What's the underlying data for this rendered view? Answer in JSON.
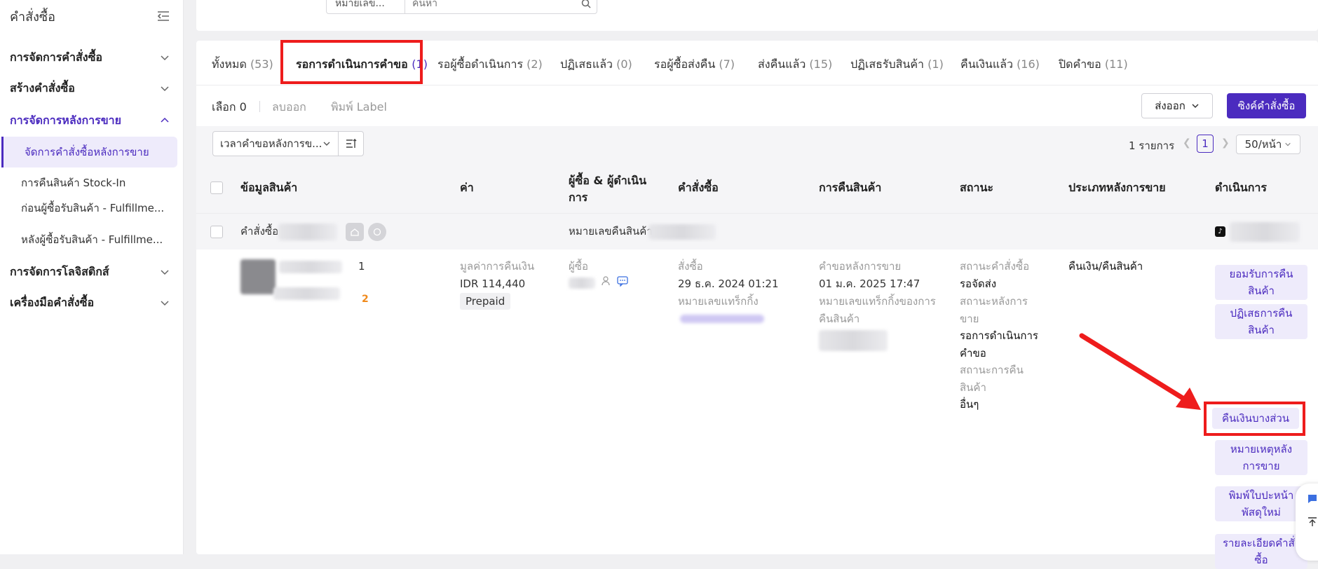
{
  "sidebar": {
    "title": "คำสั่งซื้อ",
    "items": [
      {
        "label": "การจัดการคำสั่งซื้อ"
      },
      {
        "label": "สร้างคำสั่งซื้อ"
      },
      {
        "label": "การจัดการหลังการขาย"
      },
      {
        "label": "การจัดการโลจิสติกส์"
      },
      {
        "label": "เครื่องมือคำสั่งซื้อ"
      }
    ],
    "subitems": [
      {
        "label": "จัดการคำสั่งซื้อหลังการขาย"
      },
      {
        "label": "การคืนสินค้า Stock-In"
      },
      {
        "label": "ก่อนผู้ซื้อรับสินค้า - Fulfillme..."
      },
      {
        "label": "หลังผู้ซื้อรับสินค้า - Fulfillme..."
      }
    ]
  },
  "search": {
    "type_label": "หมายเลข...",
    "placeholder": "ค้นหา"
  },
  "tabs": [
    {
      "label": "ทั้งหมด",
      "count": "(53)"
    },
    {
      "label": "รอการดำเนินการคำขอ",
      "count": "(1)"
    },
    {
      "label": "รอผู้ซื้อดำเนินการ",
      "count": "(2)"
    },
    {
      "label": "ปฏิเสธแล้ว",
      "count": "(0)"
    },
    {
      "label": "รอผู้ซื้อส่งคืน",
      "count": "(7)"
    },
    {
      "label": "ส่งคืนแล้ว",
      "count": "(15)"
    },
    {
      "label": "ปฏิเสธรับสินค้า",
      "count": "(1)"
    },
    {
      "label": "คืนเงินแล้ว",
      "count": "(16)"
    },
    {
      "label": "ปิดคำขอ",
      "count": "(11)"
    }
  ],
  "toolbar": {
    "selected": "เลือก 0",
    "remove": "ลบออก",
    "print_label": "พิมพ์ Label",
    "export": "ส่งออก",
    "sync": "ซิงค์คำสั่งซื้อ"
  },
  "filter": {
    "sort_label": "เวลาคำขอหลังการข..."
  },
  "pager": {
    "total": "1 รายการ",
    "page": "1",
    "page_size": "50/หน้า"
  },
  "table": {
    "headers": [
      "ข้อมูลสินค้า",
      "ค่า",
      "ผู้ซื้อ & ผู้ดำเนินการ",
      "คำสั่งซื้อ",
      "การคืนสินค้า",
      "สถานะ",
      "ประเภทหลังการขาย",
      "ดำเนินการ"
    ],
    "order_label": "คำสั่งซื้อ",
    "return_no_label": "หมายเลขคืนสินค้า",
    "row": {
      "product_suffix": "1",
      "quantity": "2",
      "refund_label": "มูลค่าการคืนเงิน",
      "refund_amount": "IDR 114,440",
      "payment_tag": "Prepaid",
      "buyer_label": "ผู้ซื้อ",
      "order_label": "สั่งซื้อ",
      "order_time": "29 ธ.ค. 2024 01:21",
      "tracking_label": "หมายเลขแทร็กกิ้ง",
      "after_sale_label": "คำขอหลังการขาย",
      "after_sale_time": "01 ม.ค. 2025 17:47",
      "return_tracking_label": "หมายเลขแทร็กกิ้งของการคืนสินค้า",
      "order_status_label": "สถานะคำสั่งซื้อ",
      "order_status": "รอจัดส่ง",
      "after_sale_status_label": "สถานะหลังการขาย",
      "after_sale_status": "รอการดำเนินการคำขอ",
      "return_status_label": "สถานะการคืนสินค้า",
      "return_status": "อื่นๆ",
      "after_sale_type": "คืนเงิน/คืนสินค้า"
    },
    "actions": [
      "ยอมรับการคืนสินค้า",
      "ปฏิเสธการคืนสินค้า",
      "คืนเงินบางส่วน",
      "หมายเหตุหลังการขาย",
      "พิมพ์ใบปะหน้าพัสดุใหม่",
      "รายละเอียดคำสั่งซื้อ"
    ]
  },
  "colors": {
    "accent": "#4b2bbf",
    "highlight": "#ee1c1c"
  }
}
